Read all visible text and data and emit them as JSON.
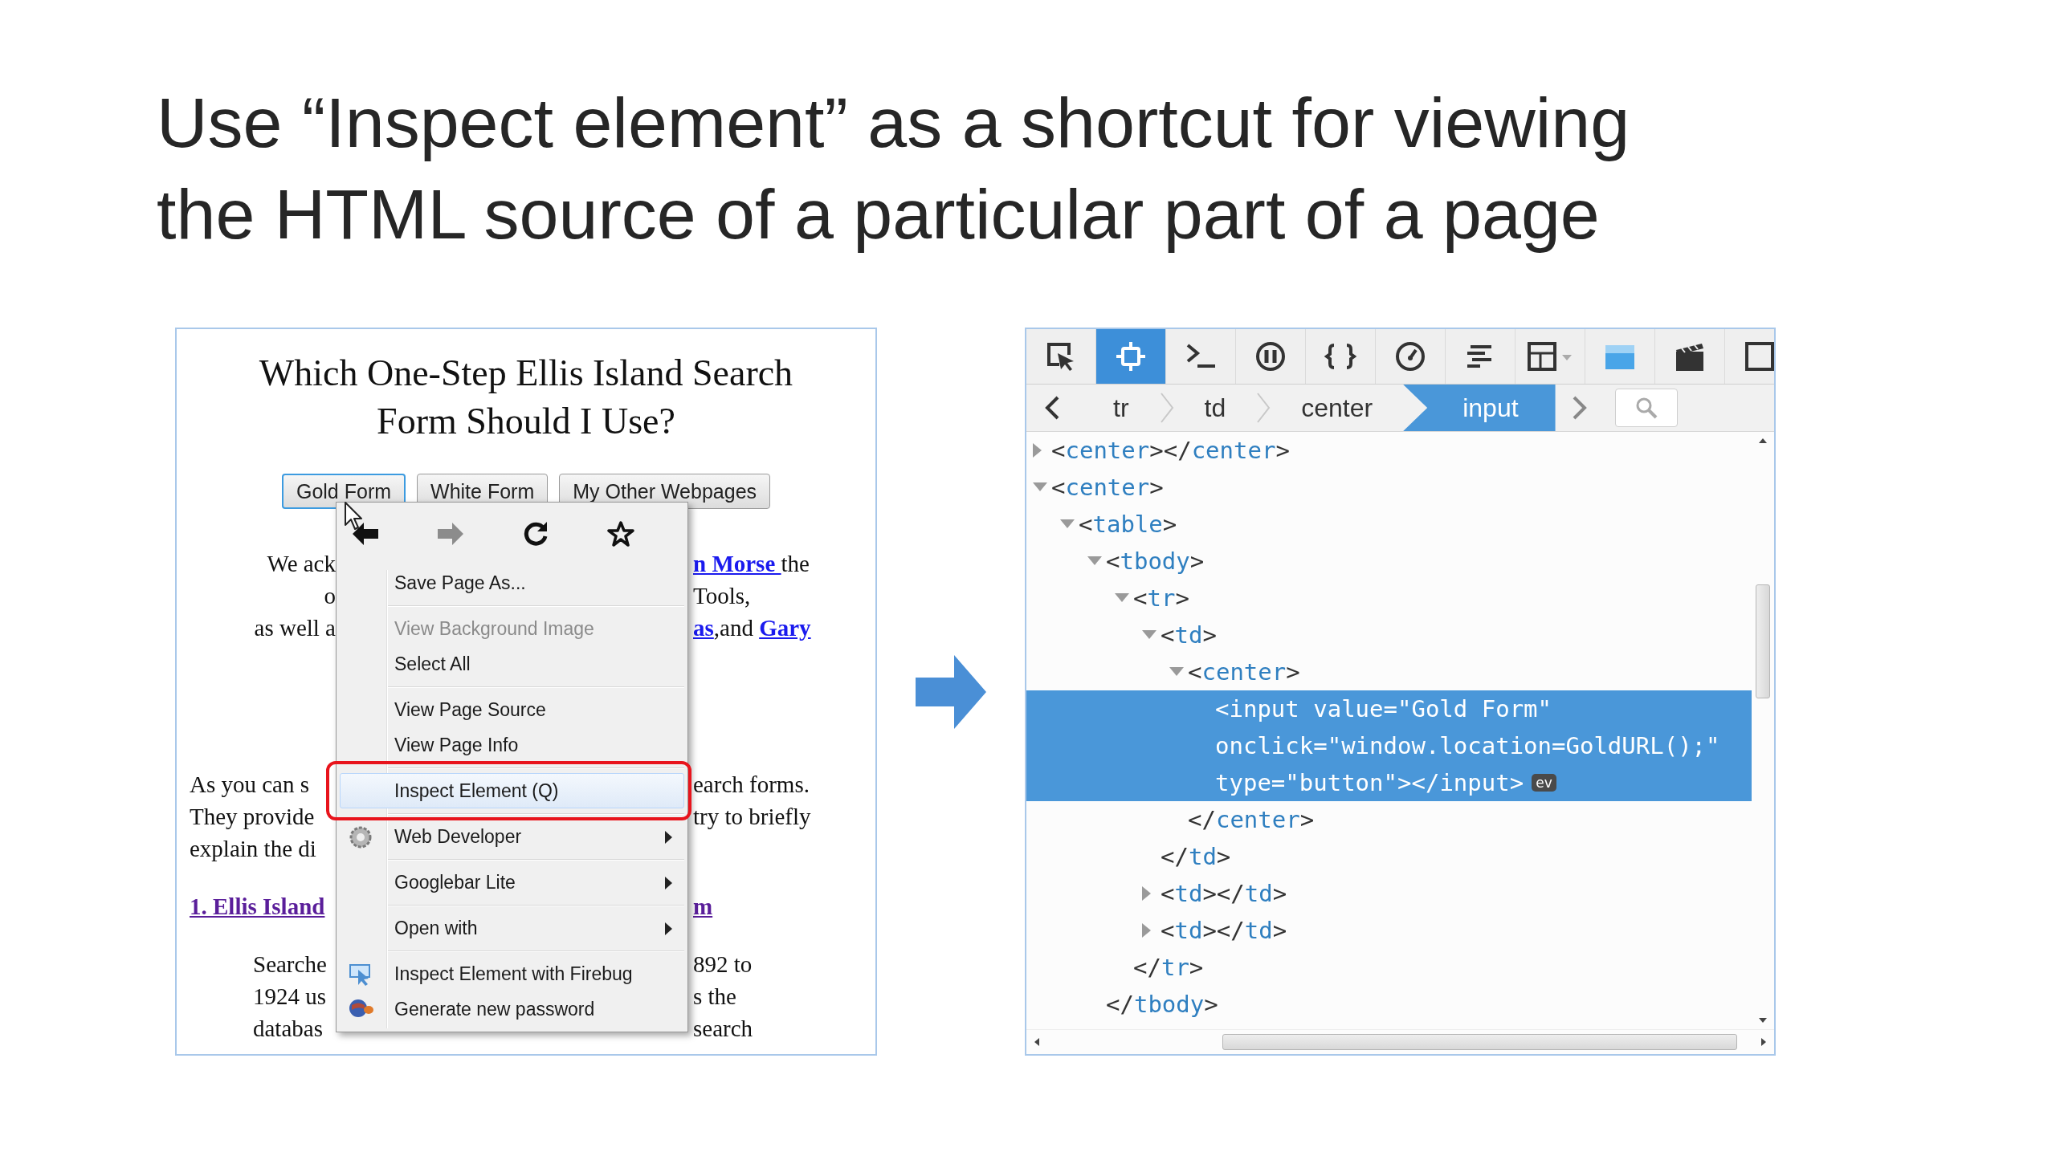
{
  "slide": {
    "title": "Use “Inspect element” as a shortcut for viewing the HTML source of a particular part of a page"
  },
  "browser_page": {
    "title": "Which One-Step Ellis Island Search Form Should I Use?",
    "buttons": [
      {
        "label": "Gold Form",
        "focused": true
      },
      {
        "label": "White Form",
        "focused": false
      },
      {
        "label": "My Other Webpages",
        "focused": false
      }
    ],
    "paragraphs": [
      {
        "kind": "center",
        "lines": [
          {
            "left": [
              {
                "text": "We ack",
                "link": false
              }
            ],
            "right": [
              {
                "text": "n Morse ",
                "link": true
              },
              {
                "text": " the",
                "link": false
              }
            ]
          },
          {
            "left": [
              {
                "text": "o",
                "link": false
              }
            ],
            "right": [
              {
                "text": "Tools,",
                "link": false
              }
            ]
          },
          {
            "left": [
              {
                "text": "as well a",
                "link": false
              }
            ],
            "right": [
              {
                "text": "as",
                "link": true
              },
              {
                "text": ",and ",
                "link": false
              },
              {
                "text": "Gary",
                "link": true
              }
            ]
          }
        ]
      },
      {
        "kind": "left",
        "lines": [
          {
            "left": [
              {
                "text": "As you can s",
                "link": false
              }
            ],
            "right": [
              {
                "text": "earch forms.",
                "link": false
              }
            ]
          },
          {
            "left": [
              {
                "text": "They provide",
                "link": false
              }
            ],
            "right": [
              {
                "text": "try to briefly",
                "link": false
              }
            ]
          },
          {
            "left": [
              {
                "text": "explain the di",
                "link": false
              }
            ]
          }
        ]
      },
      {
        "kind": "heading",
        "lines": [
          {
            "left": [
              {
                "text": "1. Ellis Island",
                "link": true
              }
            ],
            "right": [
              {
                "text": "m",
                "link": true
              }
            ]
          }
        ]
      },
      {
        "kind": "indent",
        "lines": [
          {
            "left": [
              {
                "text": "Searche",
                "link": false
              }
            ],
            "right": [
              {
                "text": "892 to",
                "link": false
              }
            ]
          },
          {
            "left": [
              {
                "text": "1924 us",
                "link": false
              }
            ],
            "right": [
              {
                "text": "s the",
                "link": false
              }
            ]
          },
          {
            "left": [
              {
                "text": "databas",
                "link": false
              }
            ],
            "right": [
              {
                "text": "search",
                "link": false
              }
            ]
          }
        ]
      }
    ]
  },
  "context_menu": {
    "nav": [
      {
        "kind": "back",
        "disabled": false
      },
      {
        "kind": "forward",
        "disabled": true
      },
      {
        "kind": "reload",
        "disabled": false
      },
      {
        "kind": "bookmark",
        "disabled": false
      }
    ],
    "items": [
      {
        "kind": "item",
        "label": "Save Page As...",
        "disabled": false,
        "selected": false,
        "circled": false,
        "submenu": false
      },
      {
        "kind": "separator"
      },
      {
        "kind": "item",
        "label": "View Background Image",
        "disabled": true,
        "selected": false,
        "circled": false,
        "submenu": false
      },
      {
        "kind": "item",
        "label": "Select All",
        "disabled": false,
        "selected": false,
        "circled": false,
        "submenu": false
      },
      {
        "kind": "separator"
      },
      {
        "kind": "item",
        "label": "View Page Source",
        "disabled": false,
        "selected": false,
        "circled": false,
        "submenu": false
      },
      {
        "kind": "item",
        "label": "View Page Info",
        "disabled": false,
        "selected": false,
        "circled": false,
        "submenu": false
      },
      {
        "kind": "separator"
      },
      {
        "kind": "item",
        "label": "Inspect Element (Q)",
        "disabled": false,
        "selected": true,
        "circled": true,
        "submenu": false
      },
      {
        "kind": "separator"
      },
      {
        "kind": "gear",
        "label": "Web Developer",
        "disabled": false,
        "selected": false,
        "circled": false,
        "submenu": true
      },
      {
        "kind": "separator"
      },
      {
        "kind": "item",
        "label": "Googlebar Lite",
        "disabled": false,
        "selected": false,
        "circled": false,
        "submenu": true
      },
      {
        "kind": "separator"
      },
      {
        "kind": "item",
        "label": "Open with",
        "disabled": false,
        "selected": false,
        "circled": false,
        "submenu": true
      },
      {
        "kind": "separator"
      },
      {
        "kind": "cursor",
        "label": "Inspect Element with Firebug",
        "disabled": false,
        "selected": false,
        "circled": false,
        "submenu": false
      },
      {
        "kind": "globe",
        "label": "Generate new password",
        "disabled": false,
        "selected": false,
        "circled": false,
        "submenu": false
      }
    ]
  },
  "devtools": {
    "toolbar": [
      {
        "kind": "pick",
        "selected": false
      },
      {
        "kind": "inspector",
        "selected": true
      },
      {
        "kind": "console",
        "selected": false
      },
      {
        "kind": "debugger",
        "selected": false
      },
      {
        "kind": "style",
        "selected": false
      },
      {
        "kind": "performance",
        "selected": false
      },
      {
        "kind": "network",
        "selected": false
      },
      {
        "kind": "layout",
        "selected": false
      },
      {
        "kind": "split-console",
        "selected": false
      },
      {
        "kind": "scratchpad",
        "selected": false
      },
      {
        "kind": "window",
        "selected": false
      }
    ],
    "breadcrumbs": [
      {
        "label": "tr",
        "selected": false
      },
      {
        "label": "td",
        "selected": false
      },
      {
        "label": "center",
        "selected": false
      },
      {
        "label": "input",
        "selected": true
      }
    ],
    "tree": [
      {
        "tag": "<center></center>",
        "expanded": false,
        "selected": false
      },
      {
        "tag": "<center>",
        "expanded": true,
        "selected": false,
        "children": [
          {
            "tag": "<table>",
            "expanded": true,
            "selected": false,
            "children": [
              {
                "tag": "<tbody>",
                "expanded": true,
                "selected": false,
                "close": "</tbody>",
                "children": [
                  {
                    "tag": "<tr>",
                    "expanded": true,
                    "selected": false,
                    "close": "</tr>",
                    "children": [
                      {
                        "tag": "<td>",
                        "expanded": true,
                        "selected": false,
                        "close": "</td>",
                        "children": [
                          {
                            "tag": "<center>",
                            "expanded": true,
                            "selected": false,
                            "close": "</center>",
                            "children": [
                              {
                                "lines": [
                                  "<input value=\"Gold Form\"",
                                  "onclick=\"window.location=GoldURL();\"",
                                  "type=\"button\"></input>"
                                ],
                                "selected": true,
                                "badge": "ev"
                              }
                            ]
                          }
                        ]
                      },
                      {
                        "tag": "<td></td>",
                        "expanded": false,
                        "selected": false
                      },
                      {
                        "tag": "<td></td>",
                        "expanded": false,
                        "selected": false
                      }
                    ]
                  }
                ]
              }
            ]
          }
        ]
      }
    ]
  }
}
